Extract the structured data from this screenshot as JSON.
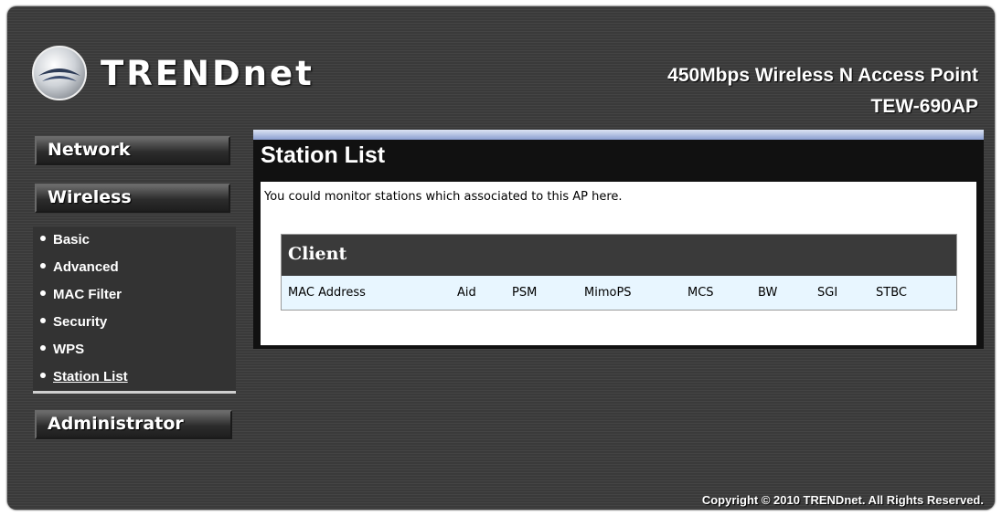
{
  "header": {
    "brand": "TRENDnet",
    "product_title": "450Mbps Wireless N Access Point",
    "model": "TEW-690AP"
  },
  "sidebar": {
    "network_label": "Network",
    "wireless_label": "Wireless",
    "administrator_label": "Administrator",
    "wireless_items": [
      {
        "label": "Basic"
      },
      {
        "label": "Advanced"
      },
      {
        "label": "MAC Filter"
      },
      {
        "label": "Security"
      },
      {
        "label": "WPS"
      },
      {
        "label": "Station List",
        "active": true
      }
    ]
  },
  "main": {
    "title": "Station List",
    "description": "You could monitor stations which associated to this AP here.",
    "table": {
      "title": "Client",
      "columns": [
        "MAC Address",
        "Aid",
        "PSM",
        "MimoPS",
        "MCS",
        "BW",
        "SGI",
        "STBC"
      ]
    }
  },
  "footer": {
    "copyright": "Copyright © 2010 TRENDnet. All Rights Reserved."
  },
  "colors": {
    "header_bar": "#3a3a3a",
    "columns_row": "#e8f6ff",
    "panel_top": "#8a9ed0"
  }
}
